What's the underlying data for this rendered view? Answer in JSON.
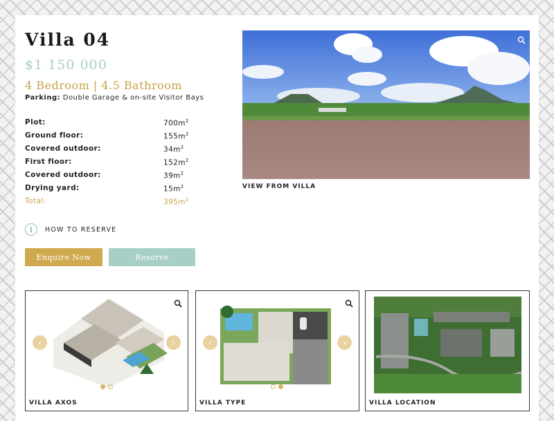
{
  "villa": {
    "title": "Villa 04",
    "price": "$1 150 000",
    "rooms": "4 Bedroom | 4.5 Bathroom",
    "parking_label": "Parking:",
    "parking_value": "Double Garage & on-site Visitor Bays"
  },
  "specs": [
    {
      "label": "Plot:",
      "value": "700m",
      "unit": "2"
    },
    {
      "label": "Ground floor:",
      "value": "155m",
      "unit": "2"
    },
    {
      "label": "Covered outdoor:",
      "value": "34m",
      "unit": "2"
    },
    {
      "label": "First floor:",
      "value": "152m",
      "unit": "2"
    },
    {
      "label": "Covered outdoor:",
      "value": "39m",
      "unit": "2"
    },
    {
      "label": "Drying yard:",
      "value": "15m",
      "unit": "2"
    },
    {
      "label": "Total:",
      "value": "395m",
      "unit": "2"
    }
  ],
  "reserve": {
    "info_icon": "i",
    "label": "HOW TO RESERVE",
    "enquire_button": "Enquire Now",
    "reserve_button": "Reserve"
  },
  "hero": {
    "caption": "VIEW FROM VILLA",
    "expand_icon": "expand-icon"
  },
  "gallery": [
    {
      "caption": "VILLA AXOS",
      "icon": "zoom-icon",
      "prev": "‹",
      "next": "›",
      "active_dot": 0,
      "dot_count": 2
    },
    {
      "caption": "VILLA TYPE",
      "icon": "zoom-icon",
      "prev": "‹",
      "next": "›",
      "active_dot": 1,
      "dot_count": 2
    },
    {
      "caption": "VILLA LOCATION"
    }
  ],
  "colors": {
    "gold": "#cfa94e",
    "mint": "#a8cfc7",
    "price": "#a9cdc7"
  }
}
